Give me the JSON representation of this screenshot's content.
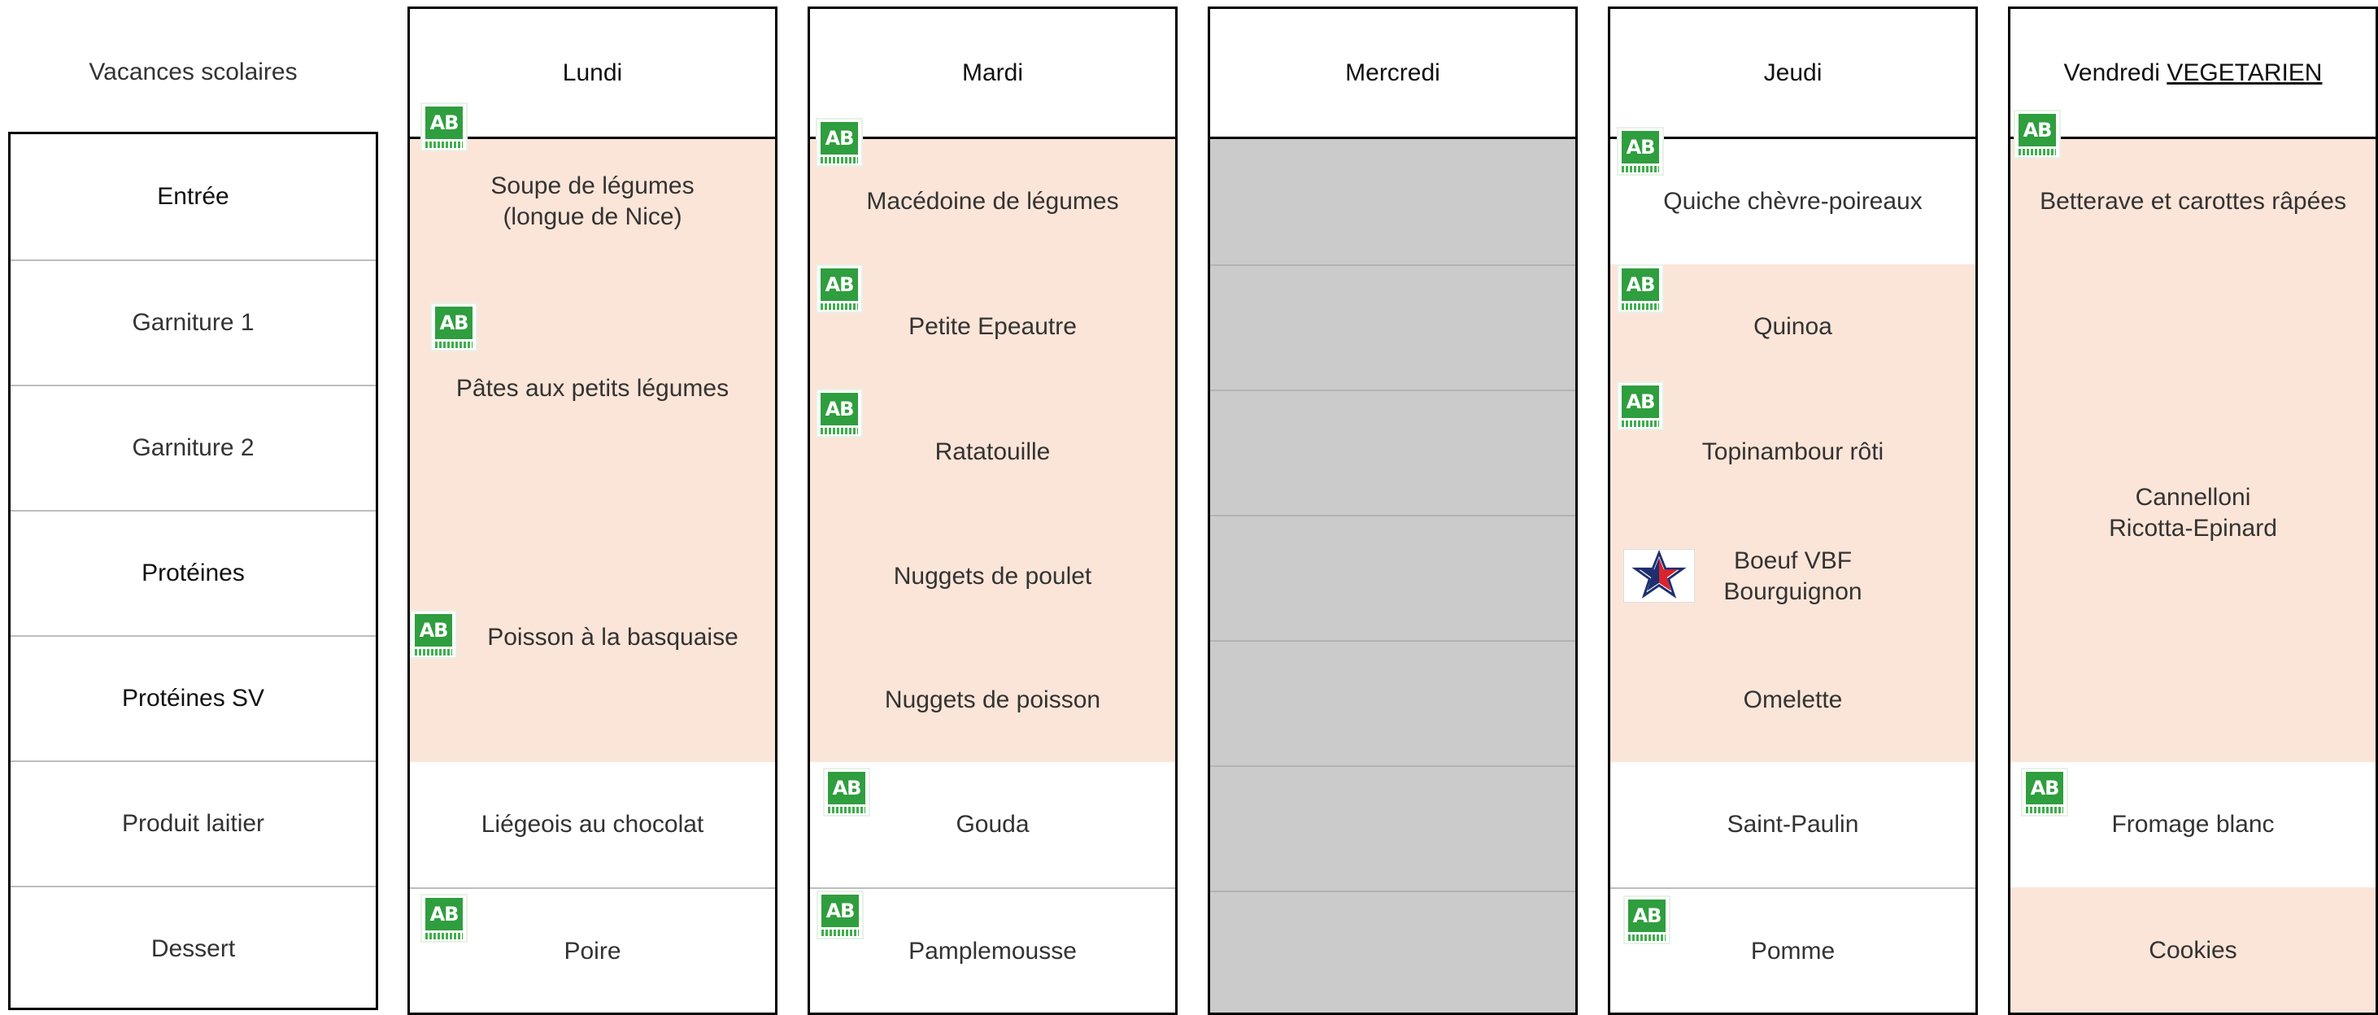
{
  "header_left": "Vacances scolaires",
  "row_labels": [
    "Entrée",
    "Garniture 1",
    "Garniture 2",
    "Protéines",
    "Protéines SV",
    "Produit laitier",
    "Dessert"
  ],
  "days": {
    "lundi": {
      "name": "Lundi",
      "entree": "Soupe de légumes\n(longue de Nice)",
      "garnitures": "Pâtes aux petits légumes",
      "proteines": "Poisson à la basquaise",
      "laitier": "Liégeois au chocolat",
      "dessert": "Poire"
    },
    "mardi": {
      "name": "Mardi",
      "entree": "Macédoine de légumes",
      "garniture1": "Petite Epeautre",
      "garniture2": "Ratatouille",
      "proteines": "Nuggets de poulet",
      "proteines_sv": "Nuggets de poisson",
      "laitier": "Gouda",
      "dessert": "Pamplemousse"
    },
    "mercredi": {
      "name": "Mercredi"
    },
    "jeudi": {
      "name": "Jeudi",
      "entree": "Quiche chèvre-poireaux",
      "garniture1": "Quinoa",
      "garniture2": "Topinambour rôti",
      "proteines": "Boeuf VBF\nBourguignon",
      "proteines_sv": "Omelette",
      "laitier": "Saint-Paulin",
      "dessert": "Pomme"
    },
    "vendredi": {
      "name": "Vendredi",
      "name_suffix": "VEGETARIEN",
      "entree": "Betterave et carottes râpées",
      "plat": "Cannelloni\nRicotta-Epinard",
      "laitier": "Fromage blanc",
      "dessert": "Cookies"
    }
  },
  "labels": {
    "ab": "AB",
    "vf": "VIANDES\nDE FRANCE"
  },
  "colors": {
    "highlight": "#fbe5d8",
    "closed": "#cbcbcb",
    "bio_green": "#2f9e3e"
  }
}
